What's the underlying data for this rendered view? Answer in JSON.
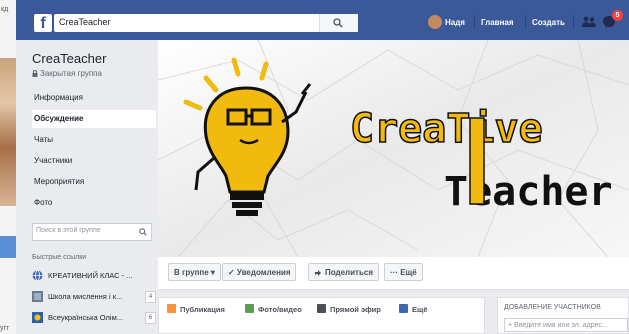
{
  "left_strip": {
    "top_text": "кд",
    "bottom_text": "угт"
  },
  "topbar": {
    "logo": "f",
    "search_value": "CreaTeacher",
    "user_name": "Надя",
    "home": "Главная",
    "create": "Создать",
    "notifications_count": "5"
  },
  "sidebar": {
    "group_name": "CreaTeacher",
    "group_type": "Закрытая группа",
    "nav": [
      {
        "label": "Информация"
      },
      {
        "label": "Обсуждение"
      },
      {
        "label": "Чаты"
      },
      {
        "label": "Участники"
      },
      {
        "label": "Мероприятия"
      },
      {
        "label": "Фото"
      }
    ],
    "search_placeholder": "Поиск в этой группе",
    "quick_links_title": "Быстрые ссылки",
    "quick_links": [
      {
        "label": "КРЕАТИВНИЙ КЛАС - ...",
        "count": ""
      },
      {
        "label": "Школа мислення і к...",
        "count": "4"
      },
      {
        "label": "Всеукраїнська Олім...",
        "count": "6"
      }
    ]
  },
  "cover": {
    "title_line1": "CreaTive",
    "title_line2": "Teacher",
    "colors": {
      "yellow": "#f2b90f",
      "black": "#111111"
    }
  },
  "actions": {
    "in_group": "В группе ▾",
    "notifications": "✓ Уведомления",
    "share": "Поделиться",
    "more": "··· Ещё"
  },
  "composer": {
    "tabs": [
      {
        "label": "Публикация"
      },
      {
        "label": "Фото/видео"
      },
      {
        "label": "Прямой эфир"
      },
      {
        "label": "Ещё"
      }
    ]
  },
  "add_members": {
    "title": "ДОБАВЛЕНИЕ УЧАСТНИКОВ",
    "placeholder": "+ Введите имя или эл. адрес..."
  }
}
